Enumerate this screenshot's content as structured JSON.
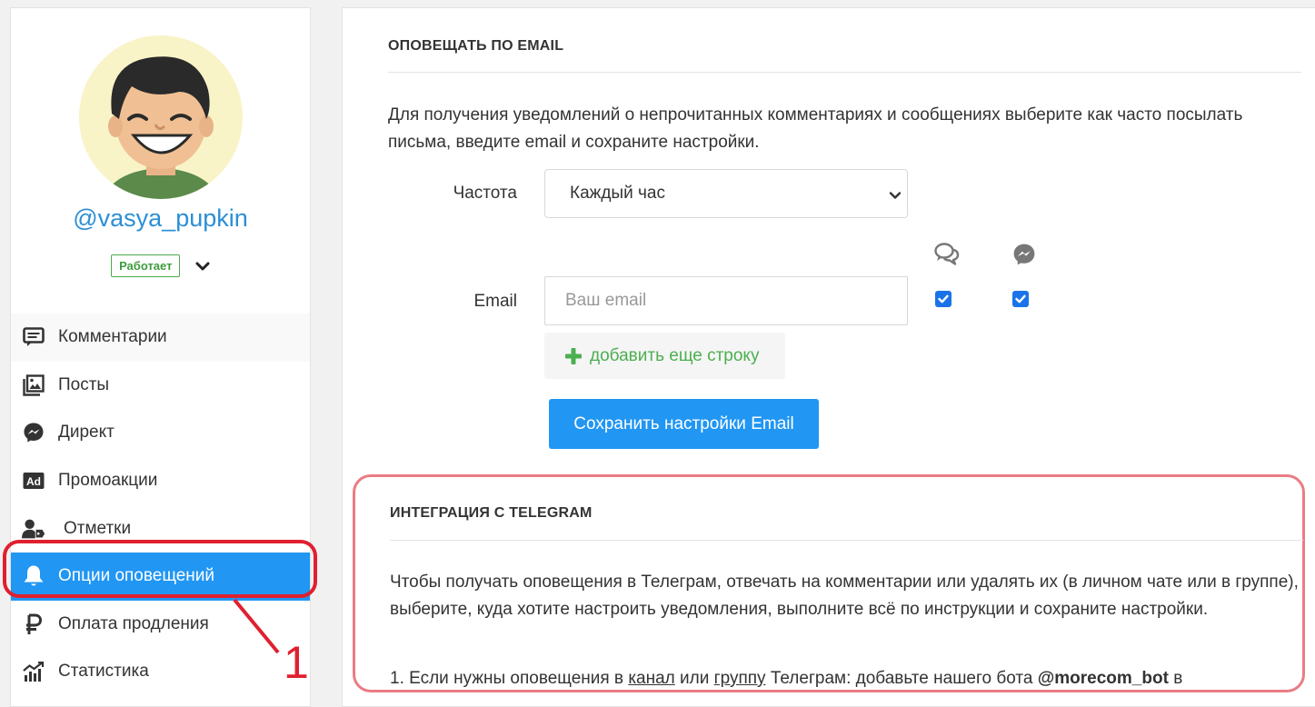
{
  "sidebar": {
    "username": "@vasya_pupkin",
    "status": "Работает",
    "menu": [
      {
        "label": "Комментарии",
        "icon": "comment-icon"
      },
      {
        "label": "Посты",
        "icon": "images-icon"
      },
      {
        "label": "Директ",
        "icon": "messenger-icon"
      },
      {
        "label": "Промоакции",
        "icon": "ad-icon"
      },
      {
        "label": "Отметки",
        "icon": "user-tag-icon"
      },
      {
        "label": "Опции оповещений",
        "icon": "bell-icon",
        "active": true
      },
      {
        "label": "Оплата продления",
        "icon": "ruble-icon"
      },
      {
        "label": "Статистика",
        "icon": "chart-icon"
      }
    ],
    "annotation_number": "1"
  },
  "email_section": {
    "title": "ОПОВЕЩАТЬ ПО EMAIL",
    "description": "Для получения уведомлений о непрочитанных комментариях и сообщениях выберите как часто посылать письма, введите email и сохраните настройки.",
    "frequency_label": "Частота",
    "frequency_value": "Каждый час",
    "email_label": "Email",
    "email_placeholder": "Ваш email",
    "comments_checked": true,
    "messages_checked": true,
    "add_row_label": "добавить еще строку",
    "save_label": "Сохранить настройки Email"
  },
  "telegram_section": {
    "title": "ИНТЕГРАЦИЯ С TELEGRAM",
    "description": "Чтобы получать оповещения в Телеграм, отвечать на комментарии или удалять их (в личном чате или в группе), выберите, куда хотите настроить уведомления, выполните всё по инструкции и сохраните настройки.",
    "step1_prefix": "1. Если нужны оповещения в",
    "step1_link_channel": "канал",
    "step1_or": "или",
    "step1_link_group": "группу",
    "step1_mid": "Телеграм: добавьте нашего бота",
    "step1_bot": "@morecom_bot",
    "step1_suffix": "в"
  },
  "colors": {
    "accent": "#2196f3",
    "link": "#2b8fd6",
    "success": "#4caf50",
    "annotation": "#e0202f"
  }
}
